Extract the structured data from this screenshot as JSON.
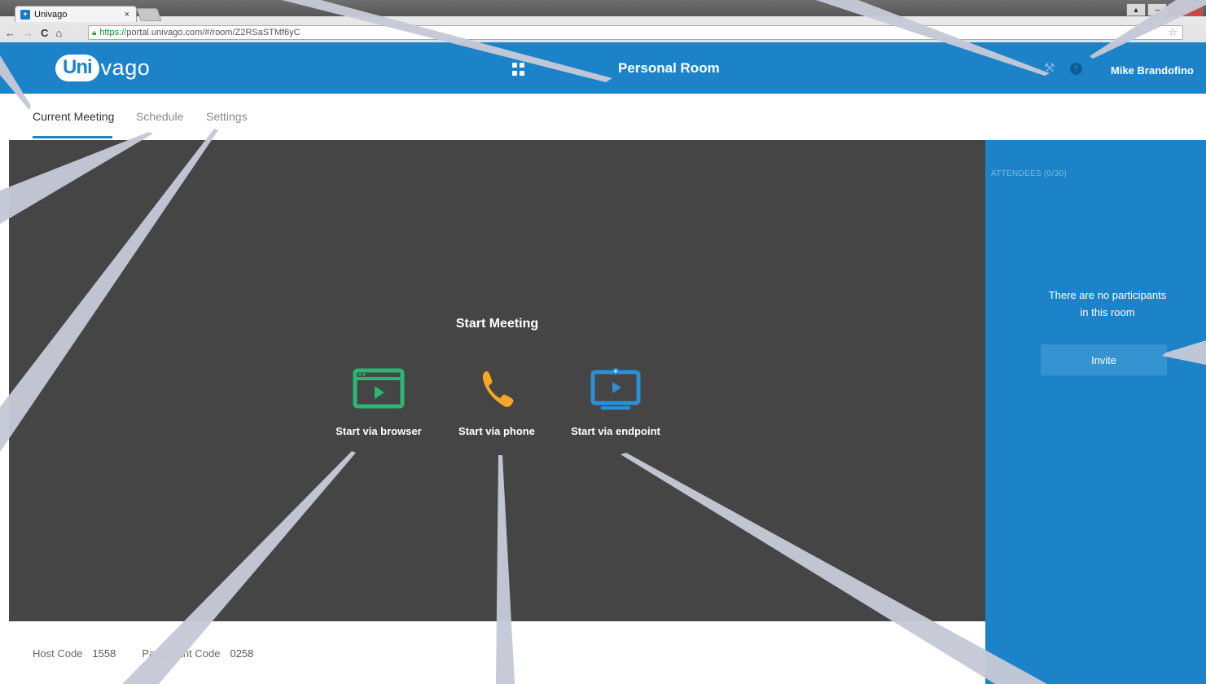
{
  "browser": {
    "tab_title": "Univago",
    "tab_close": "×",
    "url_https": "https://",
    "url_rest": "portal.univago.com/#/room/Z2RSaSTMf6yC",
    "nav": {
      "back": "←",
      "forward": "→",
      "reload": "C",
      "home": "⌂"
    }
  },
  "header": {
    "logo_cloud": "Uni",
    "logo_rest": "vago",
    "title": "Personal Room",
    "user_name": "Mike Brandofino",
    "help_glyph": "?"
  },
  "subnav": {
    "tabs": [
      {
        "label": "Current Meeting"
      },
      {
        "label": "Schedule"
      },
      {
        "label": "Settings"
      }
    ]
  },
  "stage": {
    "title": "Start Meeting",
    "options": [
      {
        "label": "Start via browser",
        "icon": "browser-icon",
        "color": "#2bb673"
      },
      {
        "label": "Start via phone",
        "icon": "phone-icon",
        "color": "#f7a823"
      },
      {
        "label": "Start via endpoint",
        "icon": "monitor-icon",
        "color": "#2d8fd5"
      }
    ]
  },
  "codes": {
    "host_label": "Host Code",
    "host_value": "1558",
    "participant_label": "Participant Code",
    "participant_value": "0258"
  },
  "attendees": {
    "title": "ATTENDEES (0/30)",
    "empty_line1": "There are no participants",
    "empty_line2": "in this room",
    "invite_label": "Invite"
  },
  "colors": {
    "brand": "#1c83c9",
    "stage_bg": "#444544",
    "callout": "#c5c8d6"
  }
}
